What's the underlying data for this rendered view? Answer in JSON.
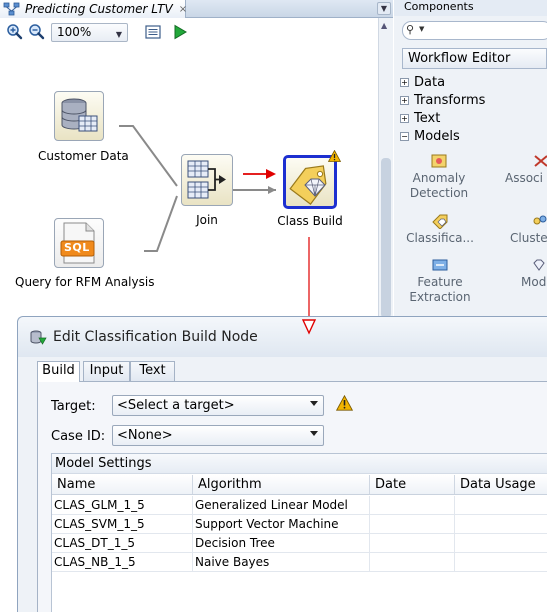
{
  "editor": {
    "tab_title": "Predicting Customer LTV",
    "tab_close": "×",
    "zoom_value": "100%"
  },
  "workflow": {
    "nodes": {
      "customer_data": "Customer Data",
      "query_rfm": "Query for RFM Analysis",
      "join": "Join",
      "class_build": "Class Build"
    },
    "sql_badge": "SQL"
  },
  "palette": {
    "header": "Components",
    "search_placeholder": "",
    "selector": "Workflow Editor",
    "categories": [
      {
        "label": "Data",
        "expanded": false
      },
      {
        "label": "Transforms",
        "expanded": false
      },
      {
        "label": "Text",
        "expanded": false
      },
      {
        "label": "Models",
        "expanded": true
      }
    ],
    "models": [
      {
        "label1": "Anomaly",
        "label2": "Detection"
      },
      {
        "label1": "Associ",
        "label2": ""
      },
      {
        "label1": "Classifica...",
        "label2": ""
      },
      {
        "label1": "Cluste",
        "label2": ""
      },
      {
        "label1": "Feature",
        "label2": "Extraction"
      },
      {
        "label1": "Mod",
        "label2": ""
      }
    ]
  },
  "dialog": {
    "title": "Edit Classification Build Node",
    "tabs": [
      "Build",
      "Input",
      "Text"
    ],
    "active_tab": "Build",
    "target_label": "Target:",
    "target_value": "<Select a target>",
    "caseid_label": "Case ID:",
    "caseid_value": "<None>",
    "model_settings_header": "Model Settings",
    "columns": [
      "Name",
      "Algorithm",
      "Date",
      "Data Usage"
    ],
    "rows": [
      {
        "name": "CLAS_GLM_1_5",
        "algorithm": "Generalized Linear Model",
        "date": "",
        "data_usage": ""
      },
      {
        "name": "CLAS_SVM_1_5",
        "algorithm": "Support Vector Machine",
        "date": "",
        "data_usage": ""
      },
      {
        "name": "CLAS_DT_1_5",
        "algorithm": "Decision Tree",
        "date": "",
        "data_usage": ""
      },
      {
        "name": "CLAS_NB_1_5",
        "algorithm": "Naive Bayes",
        "date": "",
        "data_usage": ""
      }
    ]
  },
  "colors": {
    "selection_border": "#1d2fd0",
    "annotation_arrow": "#e00000",
    "warning": "#f2b400"
  }
}
